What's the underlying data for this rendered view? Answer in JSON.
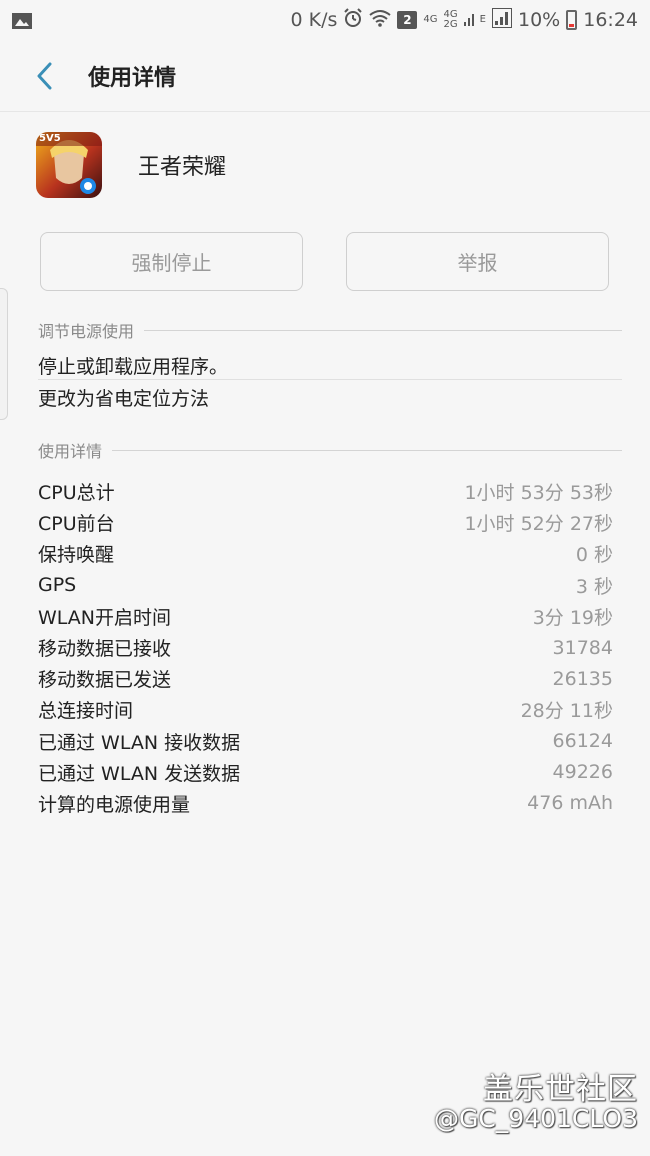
{
  "status_bar": {
    "speed": "0 K/s",
    "sim_badge": "2",
    "net_4g_a": "4G",
    "net_4g_b": "4G",
    "net_2g": "2G",
    "net_e": "E",
    "battery": "10%",
    "time": "16:24"
  },
  "app_bar": {
    "title": "使用详情"
  },
  "app": {
    "name": "王者荣耀",
    "icon_badge": "5V5"
  },
  "buttons": {
    "force_stop": "强制停止",
    "report": "举报"
  },
  "power_section": {
    "header": "调节电源使用",
    "items": [
      "停止或卸载应用程序。",
      "更改为省电定位方法"
    ]
  },
  "usage_section": {
    "header": "使用详情",
    "rows": [
      {
        "label": "CPU总计",
        "value": "1小时 53分 53秒"
      },
      {
        "label": "CPU前台",
        "value": "1小时 52分 27秒"
      },
      {
        "label": "保持唤醒",
        "value": "0 秒"
      },
      {
        "label": "GPS",
        "value": "3 秒"
      },
      {
        "label": "WLAN开启时间",
        "value": "3分 19秒"
      },
      {
        "label": "移动数据已接收",
        "value": "31784"
      },
      {
        "label": "移动数据已发送",
        "value": "26135"
      },
      {
        "label": "总连接时间",
        "value": "28分 11秒"
      },
      {
        "label": "已通过 WLAN 接收数据",
        "value": "66124"
      },
      {
        "label": "已通过 WLAN 发送数据",
        "value": "49226"
      },
      {
        "label": "计算的电源使用量",
        "value": "476 mAh"
      }
    ]
  },
  "watermark": {
    "brand": "盖乐世社区",
    "user": "@GC_9401CLO3"
  },
  "colors": {
    "accent": "#3a8fb7",
    "background": "#f6f6f6",
    "battery_low": "#e53935"
  }
}
